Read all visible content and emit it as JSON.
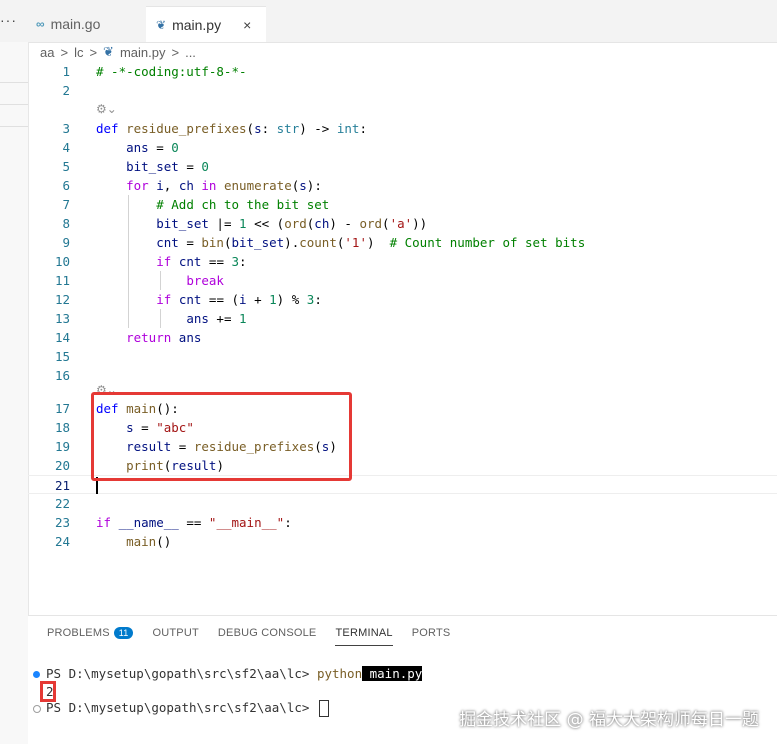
{
  "tabs": [
    {
      "label": "main.go",
      "icon": "go-file-icon",
      "active": false
    },
    {
      "label": "main.py",
      "icon": "python-file-icon",
      "active": true,
      "close": "×"
    }
  ],
  "menu_dots": "···",
  "breadcrumb": {
    "parts": [
      "aa",
      "lc",
      "main.py",
      "..."
    ],
    "sep": ">"
  },
  "code": {
    "lens_icon": "⚙⌄",
    "lines": {
      "l1": "# -*-coding:utf-8-*-",
      "n": [
        "1",
        "2",
        "3",
        "4",
        "5",
        "6",
        "7",
        "8",
        "9",
        "10",
        "11",
        "12",
        "13",
        "14",
        "15",
        "16",
        "17",
        "18",
        "19",
        "20",
        "21",
        "22",
        "23",
        "24"
      ]
    }
  },
  "panel": {
    "tabs": [
      "PROBLEMS",
      "OUTPUT",
      "DEBUG CONSOLE",
      "TERMINAL",
      "PORTS"
    ],
    "problems_count": "11",
    "active_tab": "TERMINAL",
    "prompt": "PS D:\\mysetup\\gopath\\src\\sf2\\aa\\lc>",
    "cmd_exe": "python",
    "cmd_arg": "main.py",
    "output": "2"
  },
  "watermark": "掘金技术社区 @ 福大大架构师每日一题",
  "colors": {
    "accent": "#007acc",
    "highlight": "#e53935"
  }
}
